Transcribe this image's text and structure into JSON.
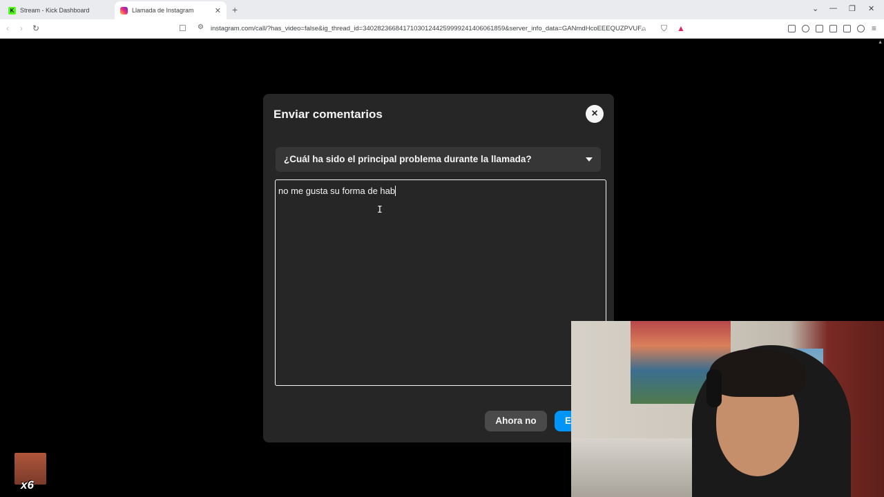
{
  "browser": {
    "tabs": [
      {
        "label": "Stream - Kick Dashboard",
        "icon": "kick-favicon"
      },
      {
        "label": "Llamada de Instagram",
        "icon": "instagram-favicon"
      }
    ],
    "url": "instagram.com/call/?has_video=false&ig_thread_id=340282366841710301244259999241406061859&server_info_data=GANmdHcoEEEQUZPVUF..."
  },
  "modal": {
    "title": "Enviar comentarios",
    "close_icon": "×",
    "select_label": "¿Cuál ha sido el principal problema durante la llamada?",
    "textarea_value": "no me gusta su forma de hab",
    "secondary_button": "Ahora no",
    "primary_button": "E"
  },
  "overlay": {
    "emote_count": "x6"
  }
}
